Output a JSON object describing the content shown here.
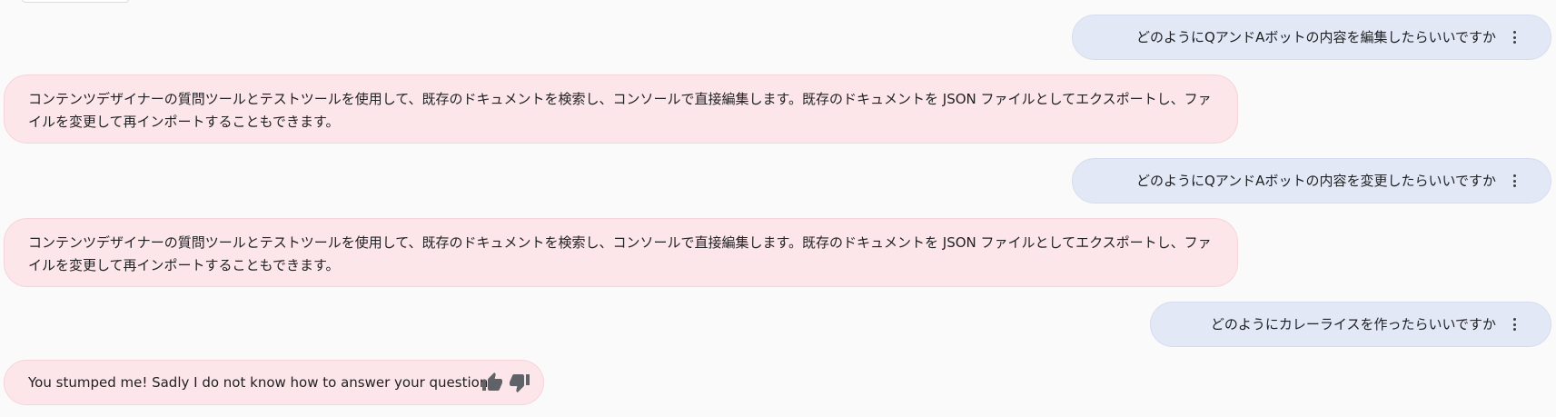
{
  "messages": [
    {
      "role": "user",
      "text": "どのようにQアンドAボットの内容を編集したらいいですか"
    },
    {
      "role": "bot",
      "text": "コンテンツデザイナーの質問ツールとテストツールを使用して、既存のドキュメントを検索し、コンソールで直接編集します。既存のドキュメントを JSON ファイルとしてエクスポートし、ファイルを変更して再インポートすることもできます。"
    },
    {
      "role": "user",
      "text": "どのようにQアンドAボットの内容を変更したらいいですか"
    },
    {
      "role": "bot",
      "text": "コンテンツデザイナーの質問ツールとテストツールを使用して、既存のドキュメントを検索し、コンソールで直接編集します。既存のドキュメントを JSON ファイルとしてエクスポートし、ファイルを変更して再インポートすることもできます。"
    },
    {
      "role": "user",
      "text": "どのようにカレーライスを作ったらいいですか"
    },
    {
      "role": "bot",
      "text": "You stumped me! Sadly I do not know how to answer your question."
    }
  ],
  "icons": {
    "message_menu": "more-vert-icon",
    "thumbs_up": "thumbs-up-icon",
    "thumbs_down": "thumbs-down-icon"
  },
  "colors": {
    "user_bubble": "#e3e8f6",
    "bot_bubble": "#fde6ea",
    "background": "#fafafa",
    "icon": "#5f6368"
  }
}
